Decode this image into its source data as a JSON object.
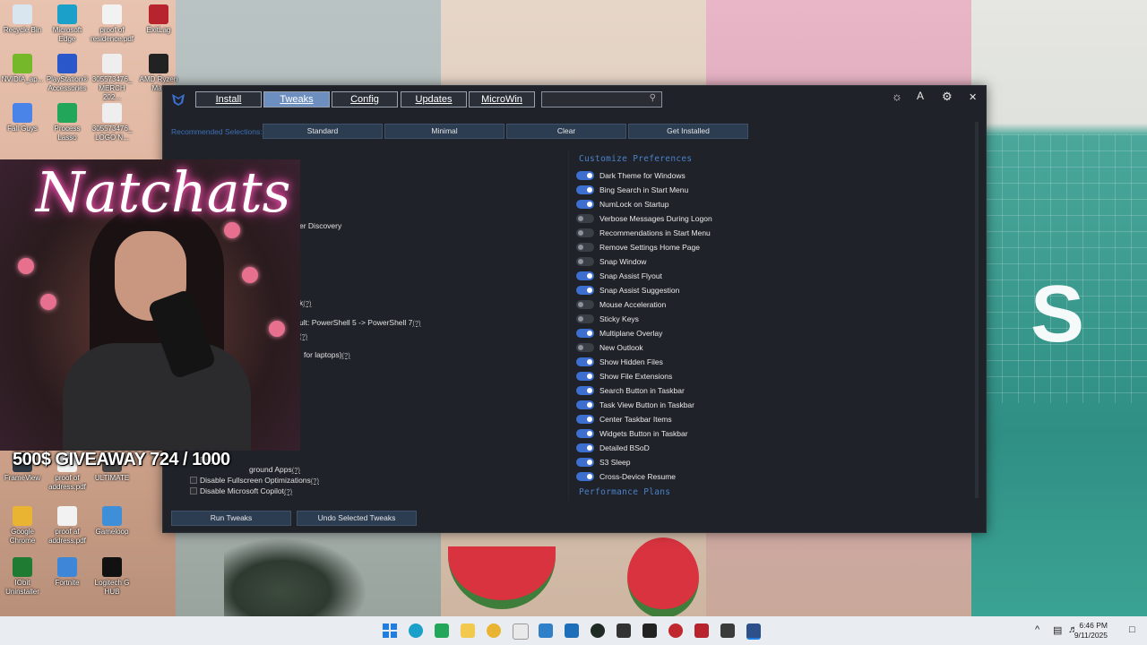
{
  "desktop": {
    "icons": [
      {
        "label": "Recycle Bin",
        "color": "#d9e6ef"
      },
      {
        "label": "Microsoft Edge",
        "color": "#1aa0c9"
      },
      {
        "label": "proof of residence.pdf",
        "color": "#f2f2f2"
      },
      {
        "label": "ExitLag",
        "color": "#b8242e"
      },
      {
        "label": "NVIDIA_ap...",
        "color": "#75b82a"
      },
      {
        "label": "PlayStation® Accessories",
        "color": "#2a57c9"
      },
      {
        "label": "305573476_ MERCH 202...",
        "color": "#eeeeee"
      },
      {
        "label": "AMD Ryzen Mas",
        "color": "#222222"
      },
      {
        "label": "Fall Guys",
        "color": "#4a84e8"
      },
      {
        "label": "Process Lasso",
        "color": "#22a65a"
      },
      {
        "label": "305573476_ LOGO N...",
        "color": "#eeeeee"
      },
      {
        "label": "FrameView",
        "color": "#2f3a44"
      },
      {
        "label": "proof of address.pdf",
        "color": "#f2f2f2"
      },
      {
        "label": "ULTIMATE",
        "color": "#444444"
      },
      {
        "label": "Google Chrome",
        "color": "#e8b431"
      },
      {
        "label": "proof af address.pdf",
        "color": "#f2f2f2"
      },
      {
        "label": "Gameloop",
        "color": "#3f8fd8"
      },
      {
        "label": "IObit Uninstaller",
        "color": "#1f7a32"
      },
      {
        "label": "Fortnite",
        "color": "#3d86d8"
      },
      {
        "label": "Logitech G HUB",
        "color": "#111111"
      }
    ]
  },
  "app": {
    "tabs": [
      "Install",
      "Tweaks",
      "Config",
      "Updates",
      "MicroWin"
    ],
    "active_tab": "Tweaks",
    "search_placeholder": "",
    "recommended_label": "Recommended Selections:",
    "recommended_buttons": [
      "Standard",
      "Minimal",
      "Clear",
      "Get Installed"
    ],
    "left_fragments": [
      "er Discovery",
      "k",
      "ult: PowerShell 5 -> PowerShell 7",
      "for laptops)",
      "Di",
      "ground Apps",
      "Disable Fullscreen Optimizations",
      "Disable Microsoft Copilot"
    ],
    "help_mark": "(?)",
    "customize_title": "Customize Preferences",
    "preferences": [
      {
        "label": "Dark Theme for Windows",
        "on": true
      },
      {
        "label": "Bing Search in Start Menu",
        "on": true
      },
      {
        "label": "NumLock on Startup",
        "on": true
      },
      {
        "label": "Verbose Messages During Logon",
        "on": false
      },
      {
        "label": "Recommendations in Start Menu",
        "on": false
      },
      {
        "label": "Remove Settings Home Page",
        "on": false
      },
      {
        "label": "Snap Window",
        "on": false
      },
      {
        "label": "Snap Assist Flyout",
        "on": true
      },
      {
        "label": "Snap Assist Suggestion",
        "on": true
      },
      {
        "label": "Mouse Acceleration",
        "on": false
      },
      {
        "label": "Sticky Keys",
        "on": false
      },
      {
        "label": "Multiplane Overlay",
        "on": true
      },
      {
        "label": "New Outlook",
        "on": false
      },
      {
        "label": "Show Hidden Files",
        "on": true
      },
      {
        "label": "Show File Extensions",
        "on": true
      },
      {
        "label": "Search Button in Taskbar",
        "on": true
      },
      {
        "label": "Task View Button in Taskbar",
        "on": true
      },
      {
        "label": "Center Taskbar Items",
        "on": true
      },
      {
        "label": "Widgets Button in Taskbar",
        "on": true
      },
      {
        "label": "Detailed BSoD",
        "on": true
      },
      {
        "label": "S3 Sleep",
        "on": true
      },
      {
        "label": "Cross-Device Resume",
        "on": true
      }
    ],
    "performance_title": "Performance Plans",
    "bottom_buttons": [
      "Run Tweaks",
      "Undo Selected Tweaks"
    ],
    "accent_color": "#3d6fd0"
  },
  "overlay": {
    "streamer_name": "Natchats",
    "giveaway": "500$ GIVEAWAY 724 / 1000"
  },
  "taskbar": {
    "time": "6:46 PM",
    "date": "9/11/2025"
  }
}
